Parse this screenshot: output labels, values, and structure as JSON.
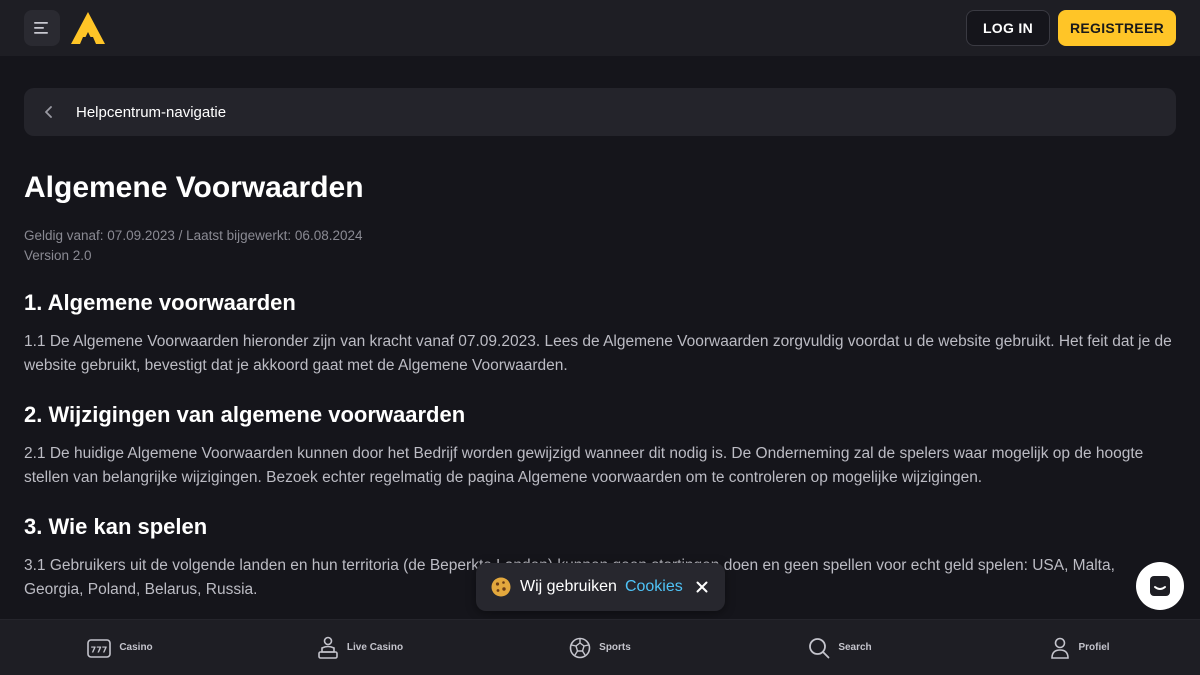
{
  "header": {
    "login_label": "LOG IN",
    "register_label": "REGISTREER",
    "accent_color": "#ffc527"
  },
  "helpnav": {
    "label": "Helpcentrum-navigatie"
  },
  "article": {
    "title": "Algemene Voorwaarden",
    "meta_line1": "Geldig vanaf: 07.09.2023 / Laatst bijgewerkt: 06.08.2024",
    "meta_line2": "Version 2.0",
    "sections": [
      {
        "title": "1. Algemene voorwaarden",
        "text": "1.1 De Algemene Voorwaarden hieronder zijn van kracht vanaf 07.09.2023. Lees de Algemene Voorwaarden zorgvuldig voordat u de website gebruikt. Het feit dat je de website gebruikt, bevestigt dat je akkoord gaat met de Algemene Voorwaarden."
      },
      {
        "title": "2. Wijzigingen van algemene voorwaarden",
        "text": "2.1 De huidige Algemene Voorwaarden kunnen door het Bedrijf worden gewijzigd wanneer dit nodig is. De Onderneming zal de spelers waar mogelijk op de hoogte stellen van belangrijke wijzigingen. Bezoek echter regelmatig de pagina Algemene voorwaarden om te controleren op mogelijke wijzigingen."
      },
      {
        "title": "3. Wie kan spelen",
        "text": "3.1 Gebruikers uit de volgende landen en hun territoria (de Beperkte Landen) kunnen geen stortingen doen en geen spellen voor echt geld spelen: USA, Malta, Georgia, Poland, Belarus, Russia."
      }
    ]
  },
  "cookie_banner": {
    "text": "Wij gebruiken",
    "link": "Cookies",
    "icon": "cookie-icon"
  },
  "bottom_nav": [
    {
      "label": "Casino",
      "icon": "slot-777-icon"
    },
    {
      "label": "Live Casino",
      "icon": "dealer-icon"
    },
    {
      "label": "Sports",
      "icon": "soccer-ball-icon"
    },
    {
      "label": "Search",
      "icon": "search-icon"
    },
    {
      "label": "Profiel",
      "icon": "user-icon"
    }
  ]
}
